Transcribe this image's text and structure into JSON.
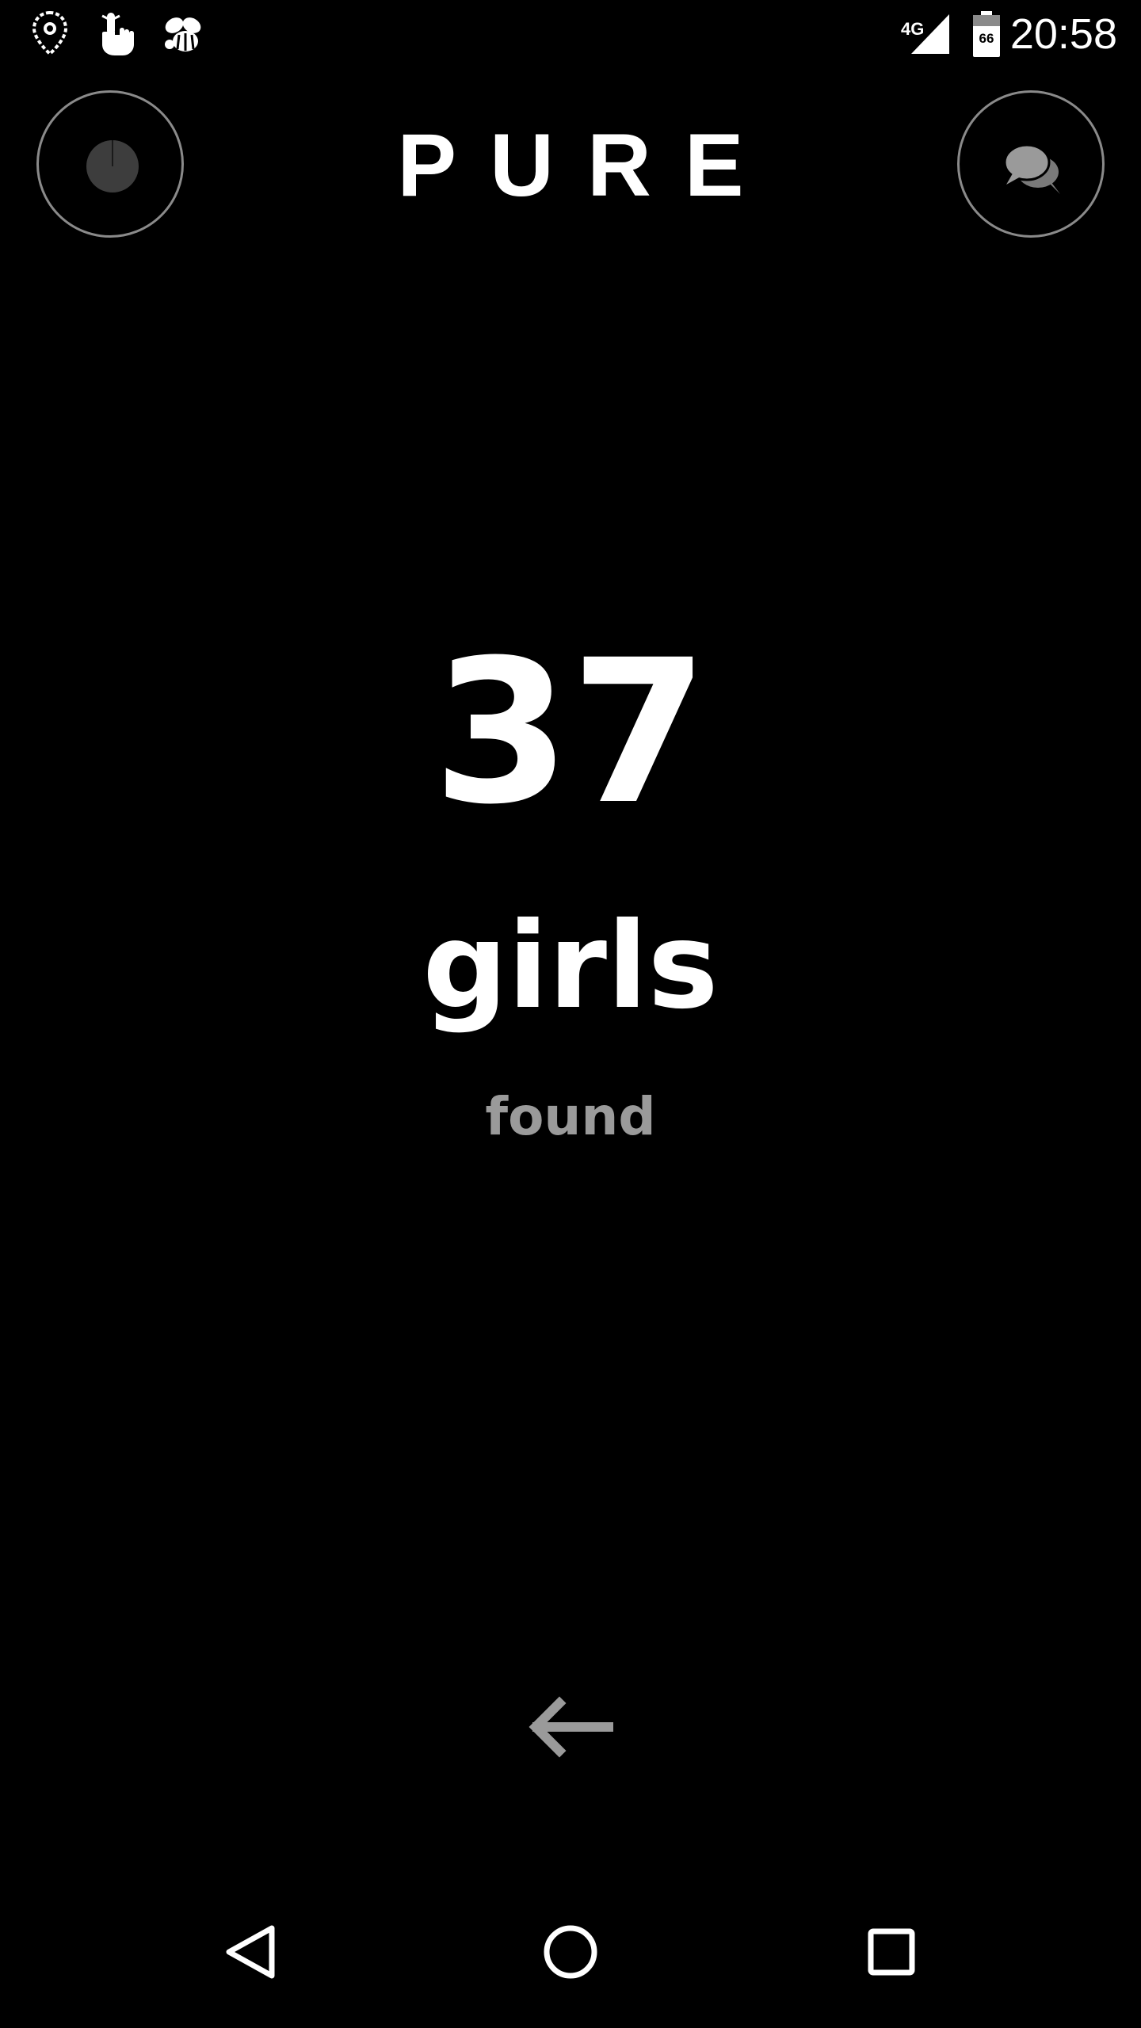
{
  "status_bar": {
    "time": "20:58",
    "network": "4G",
    "battery_level": "66",
    "left_icons": [
      "location-pin-icon",
      "touch-hand-icon",
      "bee-icon"
    ]
  },
  "header": {
    "logo": "PURE",
    "left_button_icon": "profile-dot-icon",
    "right_button_icon": "chat-bubbles-icon"
  },
  "main": {
    "count": "37",
    "noun": "girls",
    "status": "found",
    "back_icon": "left-arrow-icon"
  },
  "nav_bar": {
    "icons": [
      "back-triangle-icon",
      "home-circle-icon",
      "recents-square-icon"
    ]
  },
  "colors": {
    "background": "#000000",
    "primary_text": "#ffffff",
    "secondary_text": "#9a9a9a",
    "circle_border": "#8a8a8a"
  }
}
